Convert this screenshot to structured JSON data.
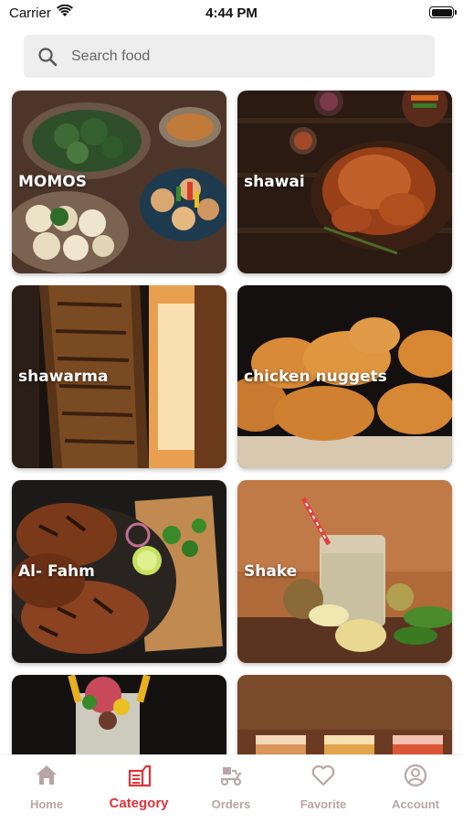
{
  "status_bar": {
    "carrier": "Carrier",
    "time": "4:44 PM"
  },
  "search": {
    "placeholder": "Search food"
  },
  "categories": [
    {
      "label": "MOMOS"
    },
    {
      "label": "shawai"
    },
    {
      "label": "shawarma"
    },
    {
      "label": "chicken nuggets"
    },
    {
      "label": "Al- Fahm"
    },
    {
      "label": "Shake"
    },
    {
      "label": ""
    },
    {
      "label": ""
    }
  ],
  "tabs": [
    {
      "label": "Home",
      "icon": "home-icon"
    },
    {
      "label": "Category",
      "icon": "category-icon",
      "active": true
    },
    {
      "label": "Orders",
      "icon": "delivery-icon"
    },
    {
      "label": "Favorite",
      "icon": "heart-icon"
    },
    {
      "label": "Account",
      "icon": "account-icon"
    }
  ],
  "colors": {
    "accent": "#e0333a",
    "inactive_tab": "#b8a6a6",
    "search_bg": "#eeeeef"
  }
}
